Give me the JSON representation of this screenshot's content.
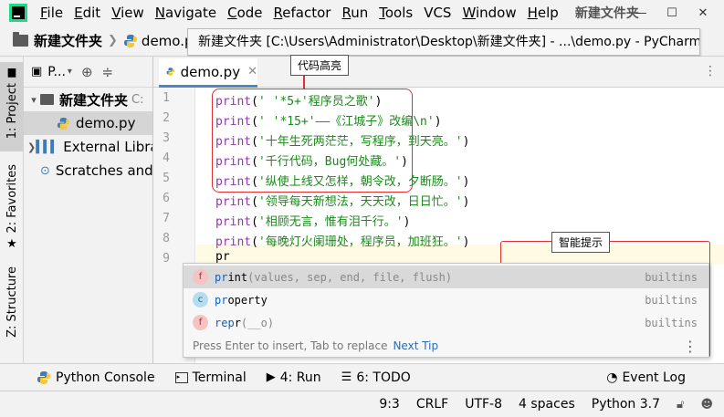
{
  "menu": {
    "items": [
      "File",
      "Edit",
      "View",
      "Navigate",
      "Code",
      "Refactor",
      "Run",
      "Tools",
      "VCS",
      "Window",
      "Help"
    ],
    "project_title": "新建文件夹"
  },
  "navbar": {
    "crumb_folder": "新建文件夹",
    "crumb_file": "demo.py",
    "tooltip": "新建文件夹 [C:\\Users\\Administrator\\Desktop\\新建文件夹] - ...\\demo.py - PyCharm"
  },
  "left_stripe": {
    "project_tab": "1: Project",
    "favorites_tab": "2: Favorites",
    "structure_tab": "Z: Structure"
  },
  "project_panel": {
    "header_label": "P...",
    "tree": [
      {
        "label": "新建文件夹",
        "hint": "C:"
      },
      {
        "label": "demo.py"
      },
      {
        "label": "External Libraries"
      },
      {
        "label": "Scratches and Consoles"
      }
    ]
  },
  "editor": {
    "tab_label": "demo.py",
    "line_numbers": [
      "1",
      "2",
      "3",
      "4",
      "5",
      "6",
      "7",
      "8",
      "9"
    ],
    "lines": [
      {
        "fn": "print",
        "open": "(",
        "arg": "' '*5+'程序员之歌'",
        "close": ")"
      },
      {
        "fn": "print",
        "open": "(",
        "arg": "' '*15+'——《江城子》改编\\n'",
        "close": ")"
      },
      {
        "fn": "print",
        "open": "(",
        "arg": "'十年生死两茫茫，写程序，到天亮。'",
        "close": ")"
      },
      {
        "fn": "print",
        "open": "(",
        "arg": "'千行代码，Bug何处藏。'",
        "close": ")"
      },
      {
        "fn": "print",
        "open": "(",
        "arg": "'纵使上线又怎样，朝令改，夕断肠。'",
        "close": ")"
      },
      {
        "fn": "print",
        "open": "(",
        "arg": "'领导每天新想法，天天改，日日忙。'",
        "close": ")"
      },
      {
        "fn": "print",
        "open": "(",
        "arg": "'相顾无言，惟有泪千行。'",
        "close": ")"
      },
      {
        "fn": "print",
        "open": "(",
        "arg": "'每晚灯火阑珊处，程序员，加班狂。'",
        "close": ")"
      },
      {
        "fn": "pr",
        "open": "",
        "arg": "",
        "close": ""
      }
    ]
  },
  "completion": {
    "items": [
      {
        "kind": "f",
        "match": "pr",
        "rest": "int",
        "sig": "(values, sep, end, file, flush)",
        "source": "builtins"
      },
      {
        "kind": "c",
        "match": "pr",
        "rest": "operty",
        "sig": "",
        "source": "builtins"
      },
      {
        "kind": "f",
        "match": "rep",
        "rest": "r",
        "sig": "(__o)",
        "source": "builtins"
      }
    ],
    "footer_hint": "Press Enter to insert, Tab to replace",
    "footer_tip": "Next Tip"
  },
  "annotations": {
    "highlight_label": "代码高亮",
    "completion_label": "智能提示"
  },
  "bottom_tools": {
    "python_console": "Python Console",
    "terminal": "Terminal",
    "run": "4: Run",
    "todo": "6: TODO",
    "event_log": "Event Log"
  },
  "status": {
    "position": "9:3",
    "line_sep": "CRLF",
    "encoding": "UTF-8",
    "indent": "4 spaces",
    "interpreter": "Python 3.7"
  }
}
